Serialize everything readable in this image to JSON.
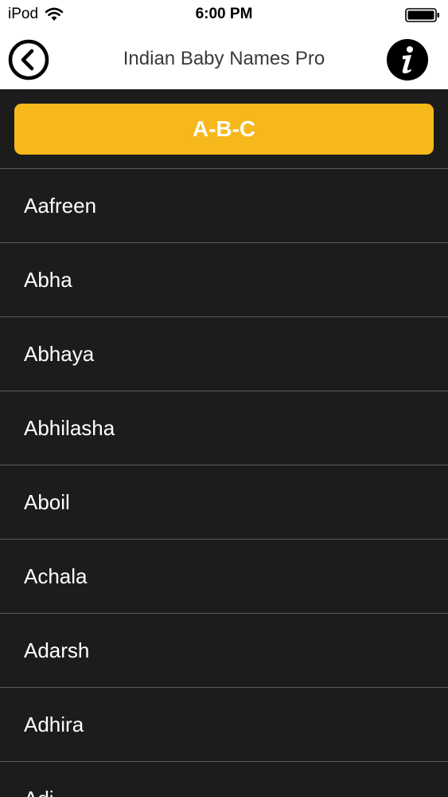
{
  "status_bar": {
    "carrier": "iPod",
    "time": "6:00 PM"
  },
  "nav": {
    "title": "Indian Baby Names Pro",
    "back_icon": "back-arrow-circle-icon",
    "info_icon": "info-icon"
  },
  "filter": {
    "label": "A-B-C"
  },
  "names": [
    "Aafreen",
    "Abha",
    "Abhaya",
    "Abhilasha",
    "Aboil",
    "Achala",
    "Adarsh",
    "Adhira",
    "Adi..."
  ],
  "colors": {
    "accent": "#f6b81a",
    "background": "#1c1c1d",
    "separator": "#5a5a5c"
  }
}
